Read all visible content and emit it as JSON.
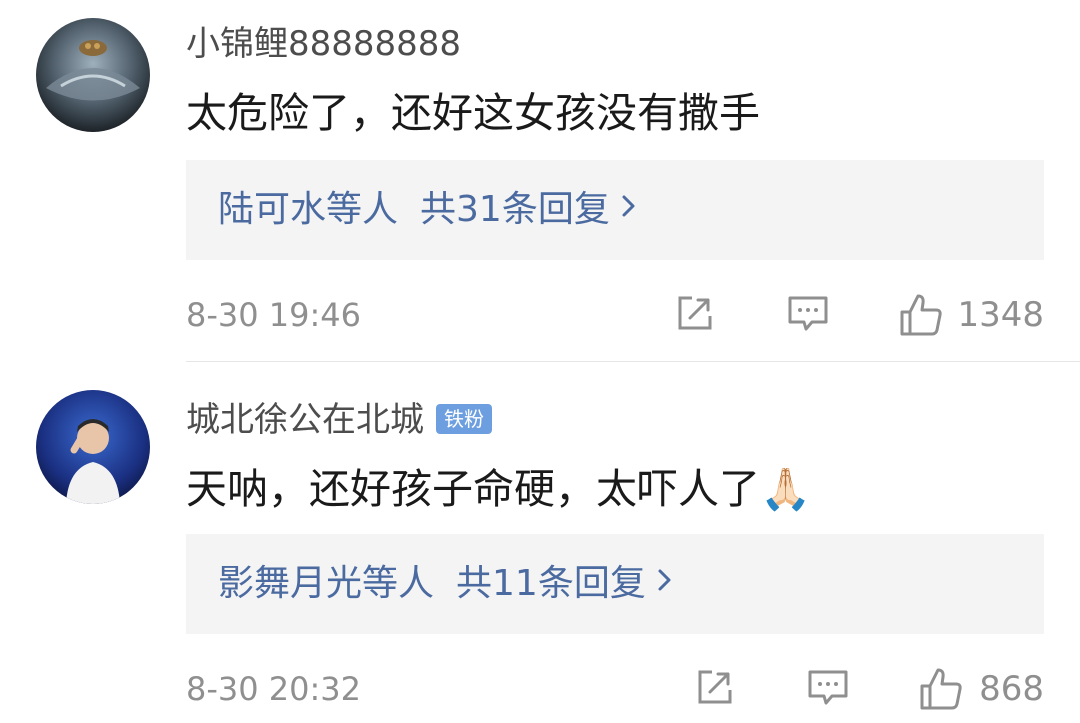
{
  "comments": [
    {
      "username": "小锦鲤88888888",
      "badge": "",
      "text": "太危险了，还好这女孩没有撒手",
      "reply_names": "陆可水等人",
      "reply_count": "共31条回复",
      "time": "8-30 19:46",
      "likes": "1348"
    },
    {
      "username": "城北徐公在北城",
      "badge": "铁粉",
      "text": "天呐，还好孩子命硬，太吓人了🙏🏻",
      "reply_names": "影舞月光等人",
      "reply_count": "共11条回复",
      "time": "8-30 20:32",
      "likes": "868"
    }
  ],
  "icons": {
    "repost": "share-edit-icon",
    "comment": "comment-icon",
    "like": "thumbs-up-icon",
    "chevron": "chevron-right-icon"
  },
  "colors": {
    "link": "#4a6aa0",
    "badge": "#6d9fe0",
    "meta": "#8f8f8f"
  }
}
